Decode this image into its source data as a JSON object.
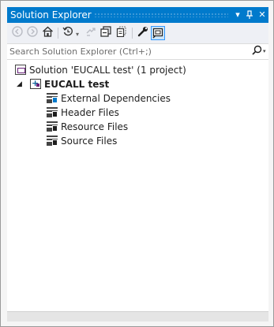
{
  "window": {
    "title": "Solution Explorer",
    "pin_glyph": "P",
    "dropdown_glyph": "▾",
    "close_glyph": "✕"
  },
  "toolbar": {
    "icons": [
      "back-icon",
      "forward-icon",
      "home-icon",
      "history-icon",
      "sync-icon",
      "collapse-all-icon",
      "show-all-files-icon",
      "properties-icon",
      "preview-icon"
    ]
  },
  "search": {
    "placeholder": "Search Solution Explorer (Ctrl+;)",
    "icon_glyph": "⌕"
  },
  "tree": {
    "solution": "Solution 'EUCALL test' (1 project)",
    "project": "EUCALL test",
    "expand_glyph": "◢",
    "items": [
      {
        "label": "External Dependencies",
        "icon": "external-dependencies-icon"
      },
      {
        "label": "Header Files",
        "icon": "filter-folder-icon"
      },
      {
        "label": "Resource Files",
        "icon": "filter-folder-icon"
      },
      {
        "label": "Source Files",
        "icon": "filter-folder-icon"
      }
    ]
  },
  "colors": {
    "titlebar": "#007acc",
    "toolbar": "#eef0f5",
    "accent": "#3399ff"
  }
}
